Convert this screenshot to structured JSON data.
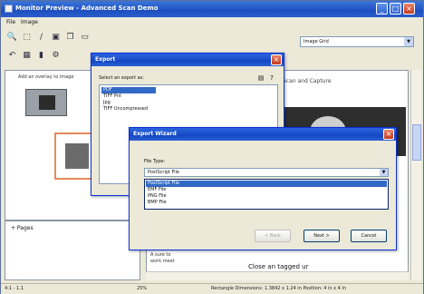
{
  "window": {
    "title": "Monitor Preview - Advanced Scan Demo",
    "controls": {
      "minimize": "_",
      "maximize": "□",
      "close": "×"
    }
  },
  "menu": [
    "File",
    "Image"
  ],
  "toolbar": {
    "zoom_combo_value": "Image Grid"
  },
  "left_panel": {
    "thumb_caption": "Add an overlay to image",
    "pages_label": "+ Pages"
  },
  "document": {
    "header_text": "Scan and Capture",
    "small_text": [
      "A sure to",
      "work meet"
    ],
    "bottom_text": "Close an tagged ur"
  },
  "status": {
    "left": "4:1 - 1.1",
    "zoom": "25%",
    "info": "Rectangle Dimensions: 1.3842 x 1.24 in   Position: 4 in x 4 in"
  },
  "export_dialog": {
    "title": "Export",
    "select_label": "Select an export as:",
    "items": [
      "PDF",
      "TIFF Pnt",
      "Jpg",
      "TIFF Uncompressed"
    ],
    "selected_index": 0
  },
  "wizard": {
    "title": "Export Wizard",
    "file_type_label": "File Type:",
    "file_type_value": "PostScript File",
    "file_types": [
      "PostScript File",
      "EMF File",
      "PNG File",
      "BMP File"
    ],
    "selected_index": 0,
    "buttons": {
      "back": "< Back",
      "next": "Next >",
      "cancel": "Cancel"
    }
  }
}
